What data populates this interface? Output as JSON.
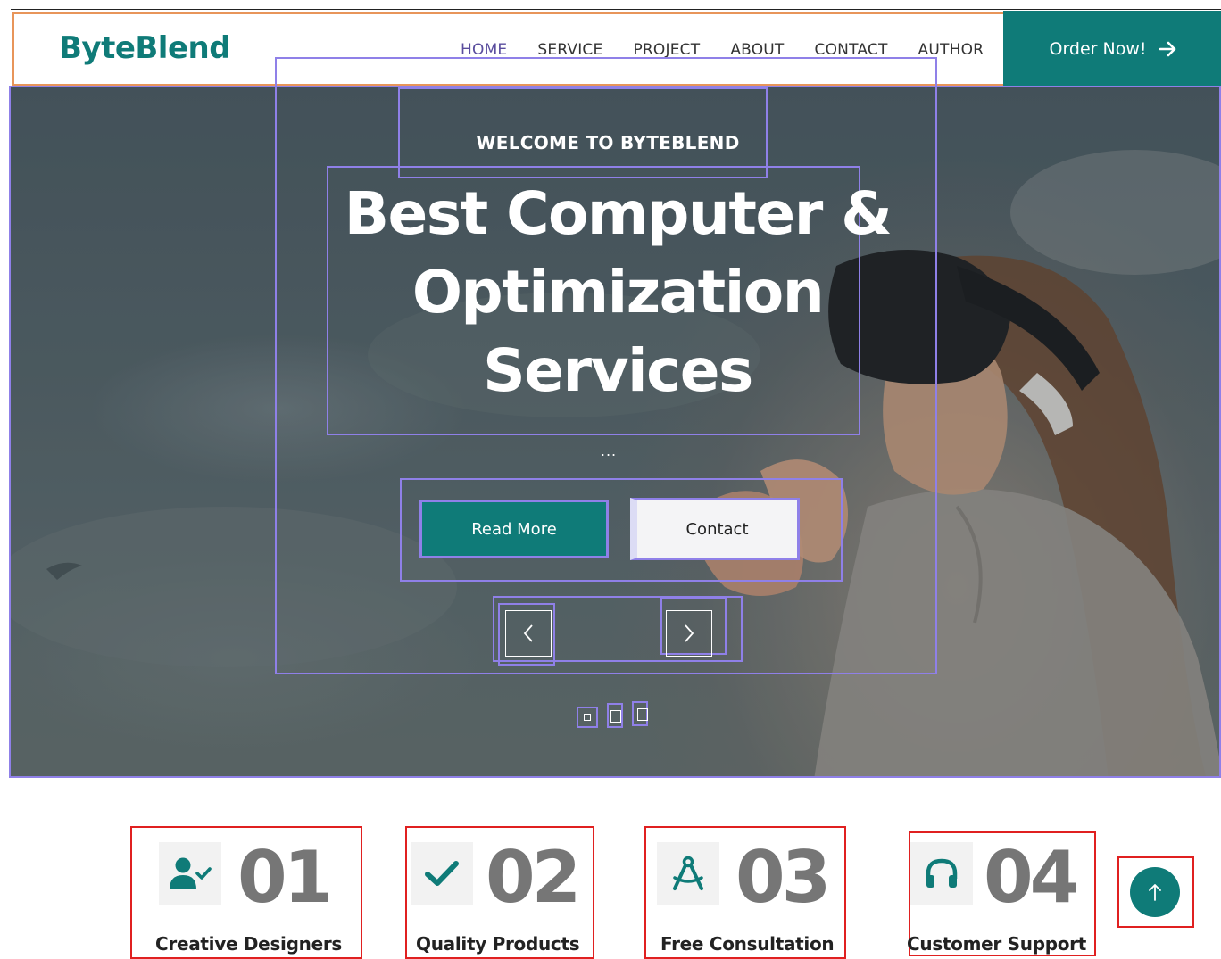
{
  "brand": {
    "logo": "ByteBlend",
    "accent_color": "#0f7b78"
  },
  "nav": {
    "items": [
      {
        "label": "HOME",
        "active": true
      },
      {
        "label": "SERVICE",
        "active": false
      },
      {
        "label": "PROJECT",
        "active": false
      },
      {
        "label": "ABOUT",
        "active": false
      },
      {
        "label": "CONTACT",
        "active": false
      },
      {
        "label": "AUTHOR",
        "active": false
      }
    ],
    "order_button": {
      "label": "Order Now!",
      "icon": "arrow-right-icon"
    }
  },
  "hero": {
    "welcome": "WELCOME TO BYTEBLEND",
    "title_lines": [
      "Best Computer &",
      "Optimization",
      "Services"
    ],
    "dots": "...",
    "read_more_label": "Read More",
    "contact_label": "Contact",
    "carousel": {
      "prev_icon": "chevron-left-icon",
      "next_icon": "chevron-right-icon",
      "indicator_count": 3
    }
  },
  "features": [
    {
      "number": "01",
      "label": "Creative Designers",
      "icon": "user-check-icon"
    },
    {
      "number": "02",
      "label": "Quality Products",
      "icon": "check-icon"
    },
    {
      "number": "03",
      "label": "Free Consultation",
      "icon": "drafting-compass-icon"
    },
    {
      "number": "04",
      "label": "Customer Support",
      "icon": "headphones-icon"
    }
  ],
  "scroll_top": {
    "icon": "arrow-up-icon"
  }
}
